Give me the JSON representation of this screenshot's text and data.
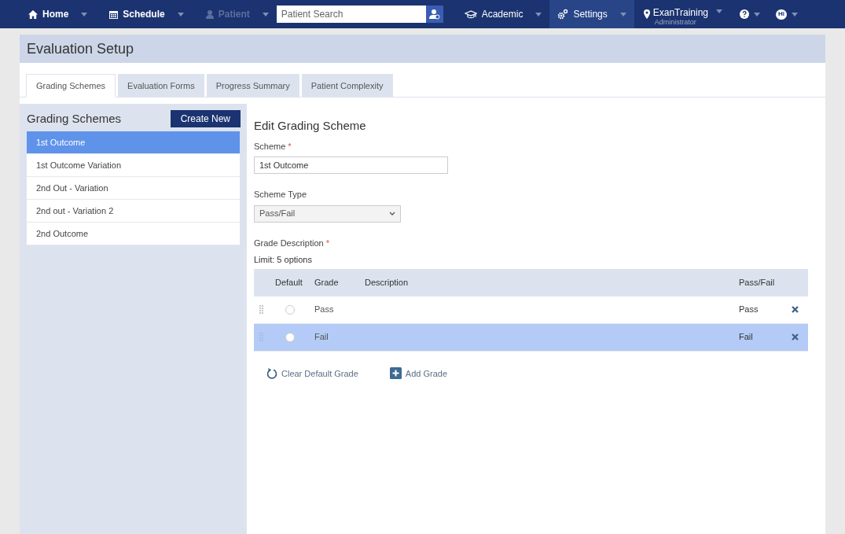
{
  "nav": {
    "left": [
      {
        "label": "Home",
        "kind": "home",
        "disabled": false
      },
      {
        "label": "Schedule",
        "kind": "calendar",
        "disabled": false
      },
      {
        "label": "Patient",
        "kind": "person",
        "disabled": true
      }
    ],
    "search": {
      "placeholder": "Patient Search"
    },
    "right": [
      {
        "label": "Academic",
        "kind": "academic",
        "selected": false
      },
      {
        "label": "Settings",
        "kind": "settings",
        "selected": true
      }
    ],
    "user": {
      "name": "ExanTraining",
      "role": "Administrator"
    },
    "chat_badge": "Hi"
  },
  "page_title": "Evaluation Setup",
  "tabs": [
    {
      "label": "Grading Schemes",
      "selected": true
    },
    {
      "label": "Evaluation Forms",
      "selected": false
    },
    {
      "label": "Progress Summary",
      "selected": false
    },
    {
      "label": "Patient Complexity",
      "selected": false
    }
  ],
  "sidebar": {
    "title": "Grading Schemes",
    "create_button": "Create New",
    "items": [
      {
        "label": "1st Outcome",
        "selected": true
      },
      {
        "label": "1st Outcome Variation",
        "selected": false
      },
      {
        "label": "2nd Out - Variation",
        "selected": false
      },
      {
        "label": "2nd out - Variation 2",
        "selected": false
      },
      {
        "label": "2nd Outcome",
        "selected": false
      }
    ]
  },
  "editor": {
    "title": "Edit Grading Scheme",
    "required_mark": "*",
    "scheme_label": "Scheme",
    "scheme_value": "1st Outcome",
    "type_label": "Scheme Type",
    "type_value": "Pass/Fail",
    "grade_label": "Grade Description",
    "limit": "Limit: 5 options",
    "columns": [
      "Default",
      "Grade",
      "Description",
      "Pass/Fail"
    ],
    "rows": [
      {
        "grade": "Pass",
        "result": "Pass",
        "selected": false,
        "default": false
      },
      {
        "grade": "Fail",
        "result": "Fail",
        "selected": true,
        "default": false
      }
    ],
    "clear_button": "Clear Default Grade",
    "add_button": "Add Grade"
  }
}
